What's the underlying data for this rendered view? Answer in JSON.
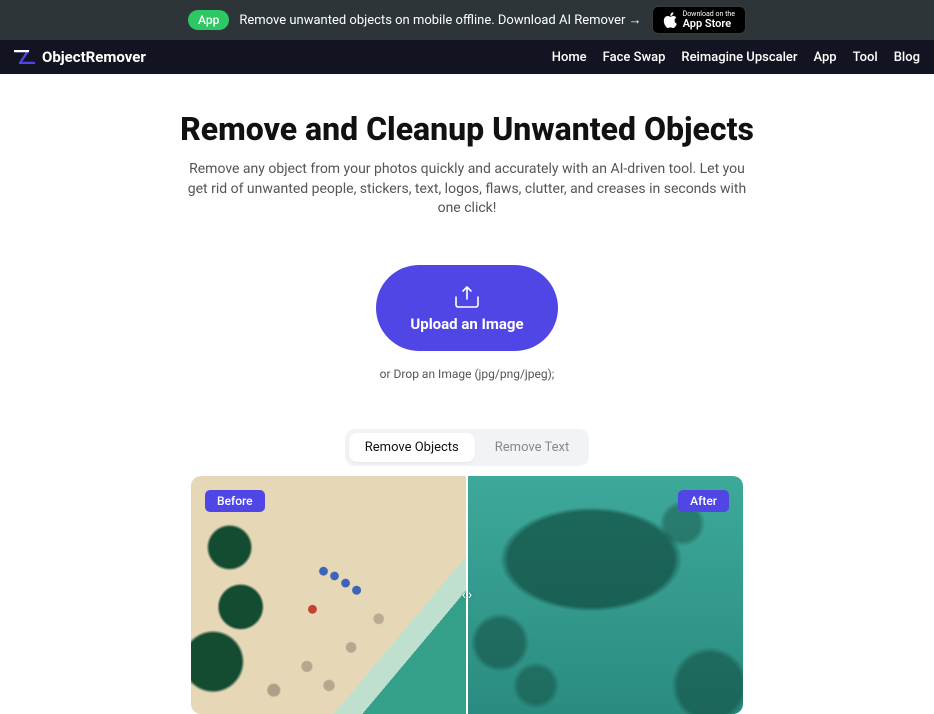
{
  "banner": {
    "badge": "App",
    "text": "Remove unwanted objects on mobile offline. Download AI Remover →",
    "appstore_small": "Download on the",
    "appstore_big": "App Store"
  },
  "brand": {
    "name": "ObjectRemover"
  },
  "nav": {
    "items": [
      {
        "label": "Home"
      },
      {
        "label": "Face Swap"
      },
      {
        "label": "Reimagine Upscaler"
      },
      {
        "label": "App"
      },
      {
        "label": "Tool"
      },
      {
        "label": "Blog"
      }
    ]
  },
  "hero": {
    "title": "Remove and Cleanup Unwanted Objects",
    "subtitle": "Remove any object from your photos quickly and accurately with an AI-driven tool. Let you get rid of unwanted people, stickers, text, logos, flaws, clutter, and creases in seconds with one click!"
  },
  "upload": {
    "button": "Upload an Image",
    "hint": "or Drop an Image (jpg/png/jpeg);"
  },
  "tabs": {
    "items": [
      {
        "label": "Remove Objects",
        "active": true
      },
      {
        "label": "Remove Text",
        "active": false
      }
    ]
  },
  "compare": {
    "before": "Before",
    "after": "After"
  }
}
